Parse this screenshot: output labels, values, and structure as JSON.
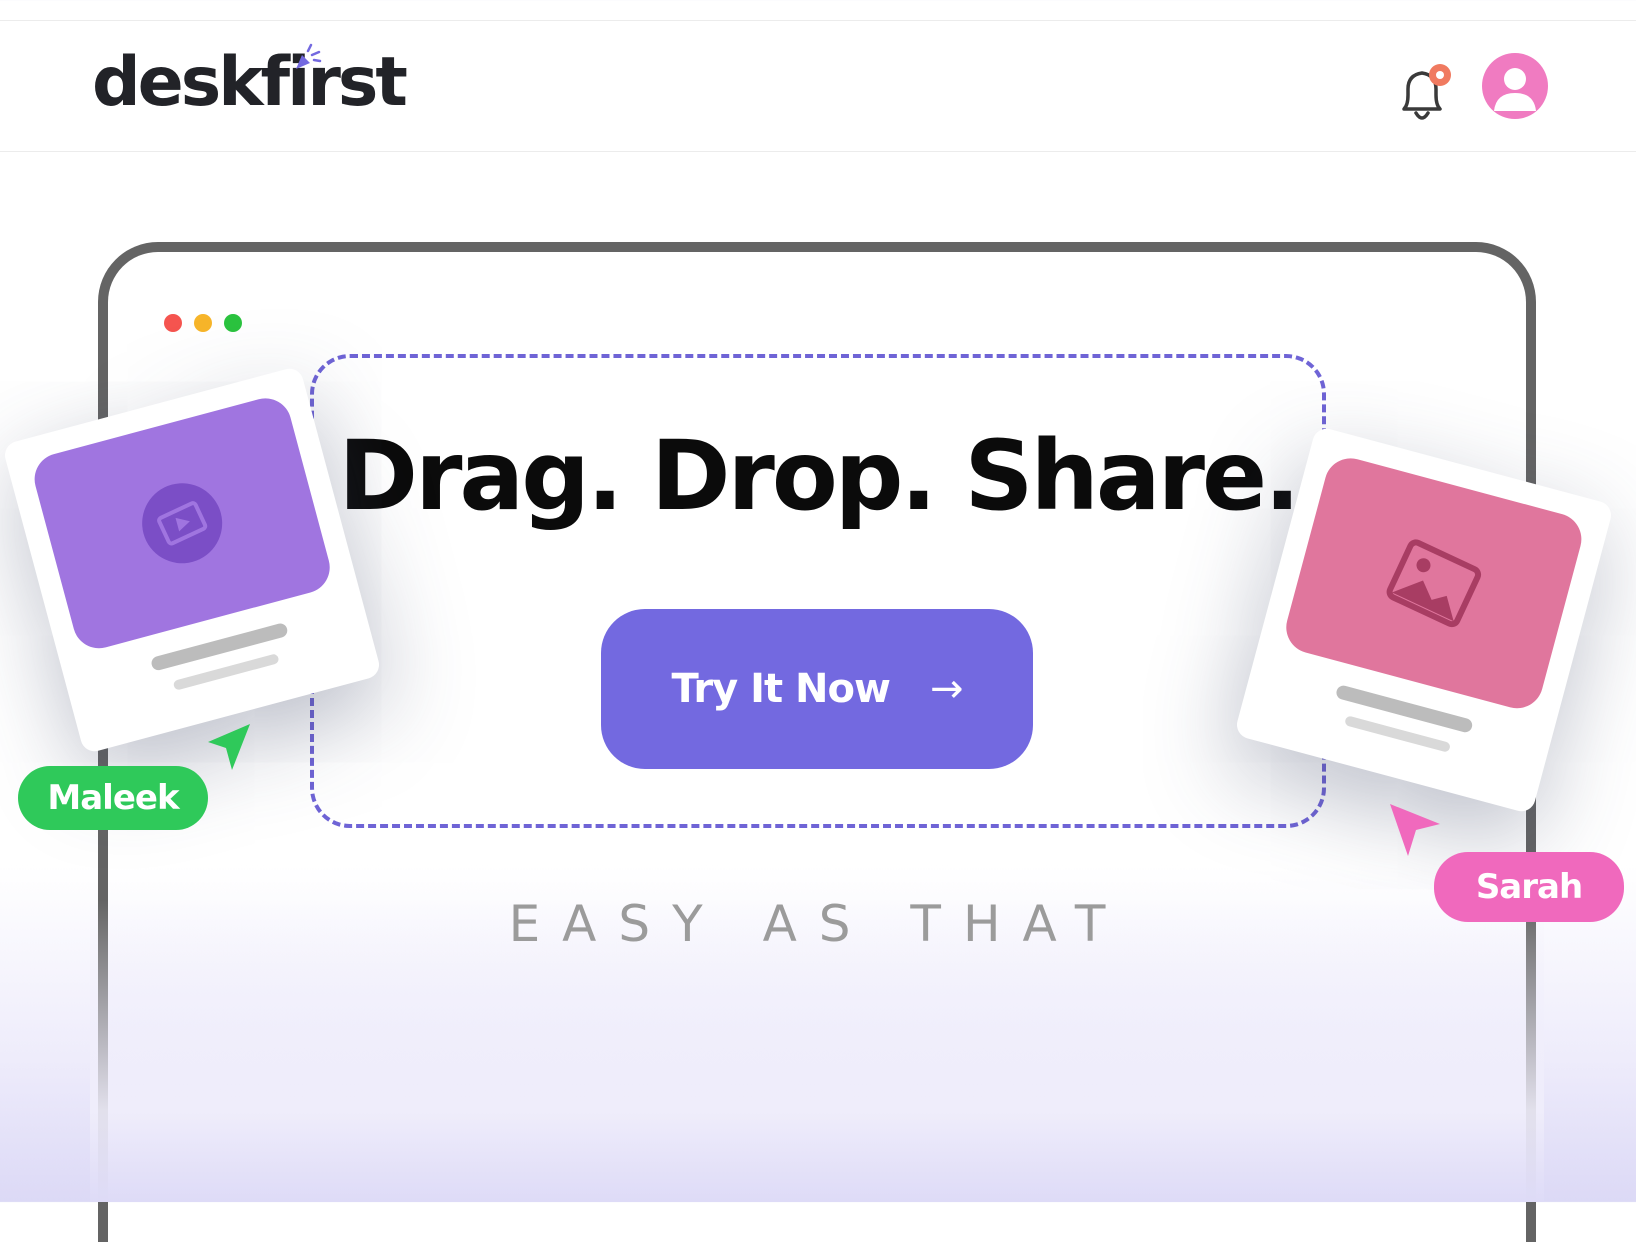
{
  "header": {
    "logo_text": "deskfirst",
    "icons": [
      "bell-icon",
      "user-avatar-icon"
    ],
    "notification_dot_color": "#f07a60",
    "avatar_color": "#f07bc1"
  },
  "window": {
    "controls": [
      "close-dot",
      "minimize-dot",
      "maximize-dot"
    ]
  },
  "hero": {
    "headline": "Drag. Drop. Share.",
    "cta_label": "Try It Now",
    "cta_arrow": "→",
    "tagline": "EASY AS THAT",
    "accent_color": "#7369e0"
  },
  "cards": {
    "left": {
      "type": "video",
      "icon": "video-play-icon",
      "color": "#a075e0"
    },
    "right": {
      "type": "image",
      "icon": "image-icon",
      "color": "#e0769d"
    }
  },
  "collaborators": [
    {
      "name": "Maleek",
      "color": "#2fc95a"
    },
    {
      "name": "Sarah",
      "color": "#f069bd"
    }
  ]
}
